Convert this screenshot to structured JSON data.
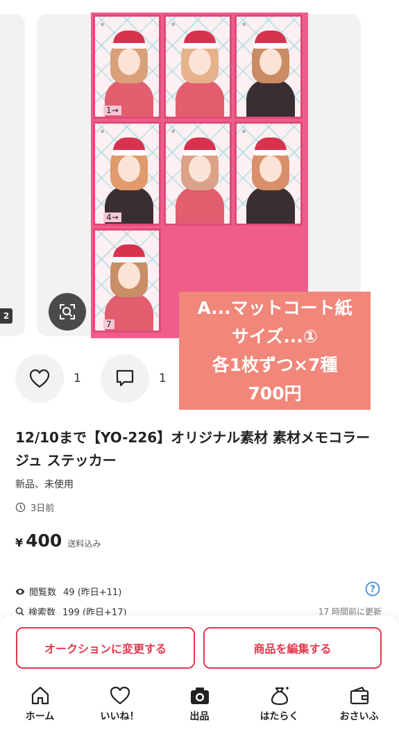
{
  "carousel": {
    "prev_index": "2",
    "card_labels": [
      "1→",
      "4→",
      "7"
    ],
    "overlay_lines": [
      "A...マットコート紙",
      "サイズ...①",
      "各1枚ずつ×7種",
      "700円"
    ]
  },
  "actions": {
    "like_count": "1",
    "comment_count": "1"
  },
  "item": {
    "title": "12/10まで【YO-226】オリジナル素材 素材メモコラージュ ステッカー",
    "condition": "新品、未使用",
    "posted": "3日前",
    "currency": "¥",
    "price": "400",
    "shipping": "送料込み"
  },
  "stats": {
    "views_label": "閲覧数",
    "views_value": "49 (昨日+11)",
    "search_label": "検索数",
    "search_value": "199 (昨日+17)",
    "updated": "17 時間前に更新"
  },
  "buttons": {
    "auction": "オークションに変更する",
    "edit": "商品を編集する"
  },
  "tabbar": [
    {
      "label": "ホーム",
      "icon": "home-icon"
    },
    {
      "label": "いいね！",
      "icon": "heart-icon"
    },
    {
      "label": "出品",
      "icon": "camera-icon"
    },
    {
      "label": "はたらく",
      "icon": "money-bag-icon"
    },
    {
      "label": "おさいふ",
      "icon": "wallet-icon"
    }
  ],
  "colors": {
    "accent": "#e2384d",
    "sheet_pink": "#ef5d8a",
    "overlay": "#f0877a",
    "info_blue": "#3a8fd9"
  }
}
